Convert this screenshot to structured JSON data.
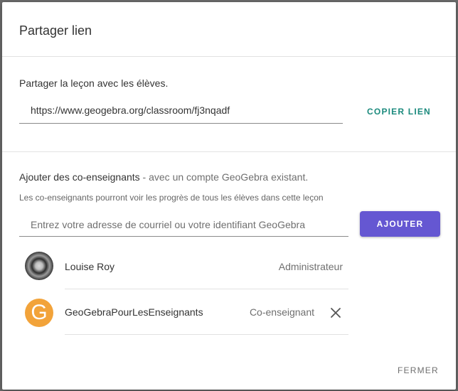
{
  "dialog": {
    "title": "Partager lien",
    "close_label": "FERMER"
  },
  "share": {
    "label": "Partager la leçon avec les élèves.",
    "link": "https://www.geogebra.org/classroom/fj3nqadf",
    "copy_label": "COPIER LIEN"
  },
  "coteachers": {
    "label": "Ajouter des co-enseignants",
    "label_suffix": " - avec un compte GeoGebra existant.",
    "description": "Les co-enseignants pourront voir les progrès de tous les élèves dans cette leçon",
    "input_placeholder": "Entrez votre adresse de courriel ou votre identifiant GeoGebra",
    "add_label": "AJOUTER",
    "members": [
      {
        "name": "Louise Roy",
        "role": "Administrateur",
        "avatar": "photo-avatar"
      },
      {
        "name": "GeoGebraPourLesEnseignants",
        "role": "Co-enseignant",
        "avatar": "geogebra-g-avatar",
        "avatar_letter": "G"
      }
    ]
  },
  "colors": {
    "accent": "#6557d2",
    "link_button": "#1b8a7d",
    "avatar_orange": "#f2a33a"
  },
  "icons": {
    "remove": "close-x-icon"
  }
}
